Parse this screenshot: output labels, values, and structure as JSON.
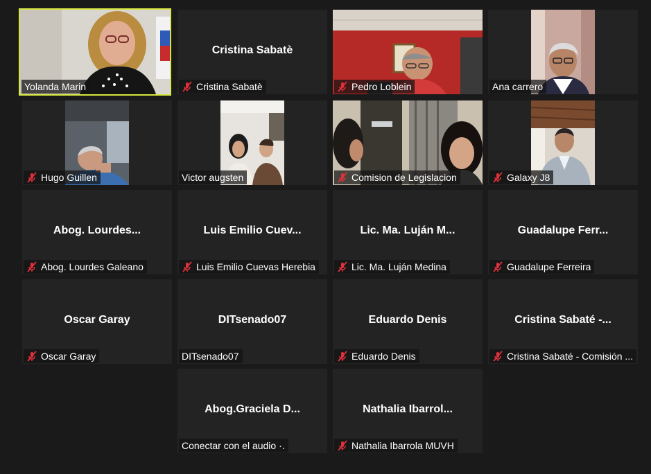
{
  "colors": {
    "background": "#1a1a1a",
    "tile": "#232323",
    "active_speaker_border": "#d8e83a",
    "mute_icon": "#e0313b",
    "text": "#ffffff"
  },
  "participants": [
    {
      "id": "yolanda",
      "label": "Yolanda Marin",
      "muted": false,
      "video": true,
      "active": true
    },
    {
      "id": "cristina1",
      "center_name": "Cristina Sabatè",
      "label": "Cristina Sabatè",
      "muted": true,
      "video": false
    },
    {
      "id": "pedro",
      "label": "Pedro Loblein",
      "muted": true,
      "video": true
    },
    {
      "id": "ana",
      "label": "Ana carrero",
      "muted": false,
      "video": true
    },
    {
      "id": "hugo",
      "label": "Hugo Guillen",
      "muted": true,
      "video": true
    },
    {
      "id": "victor",
      "label": "Victor augsten",
      "muted": false,
      "video": true
    },
    {
      "id": "comision",
      "label": "Comision de Legislacion",
      "muted": true,
      "video": true
    },
    {
      "id": "galaxy",
      "label": "Galaxy J8",
      "muted": true,
      "video": true
    },
    {
      "id": "lourdes",
      "center_name": "Abog.  Lourdes...",
      "label": "Abog. Lourdes Galeano",
      "muted": true,
      "video": false
    },
    {
      "id": "luis",
      "center_name": "Luis  Emilio  Cuev...",
      "label": "Luis Emilio Cuevas Herebia",
      "muted": true,
      "video": false
    },
    {
      "id": "lujan",
      "center_name": "Lic.  Ma.  Luján  M...",
      "label": "Lic. Ma. Luján Medina",
      "muted": true,
      "video": false
    },
    {
      "id": "guadalupe",
      "center_name": "Guadalupe  Ferr...",
      "label": "Guadalupe Ferreira",
      "muted": true,
      "video": false
    },
    {
      "id": "oscar",
      "center_name": "Oscar Garay",
      "label": "Oscar Garay",
      "muted": true,
      "video": false
    },
    {
      "id": "dit",
      "center_name": "DITsenado07",
      "label": "DITsenado07",
      "muted": false,
      "video": false
    },
    {
      "id": "eduardo",
      "center_name": "Eduardo Denis",
      "label": "Eduardo Denis",
      "muted": true,
      "video": false
    },
    {
      "id": "cristina2",
      "center_name": "Cristina  Sabaté  -...",
      "label": "Cristina Sabaté - Comisión ...",
      "muted": true,
      "video": false
    },
    {
      "id": "graciela",
      "center_name": "Abog.Graciela  D...",
      "label": "Conectar con el audio ·.",
      "muted": false,
      "video": false
    },
    {
      "id": "nathalia",
      "center_name": "Nathalia  Ibarrol...",
      "label": "Nathalia Ibarrola MUVH",
      "muted": true,
      "video": false
    }
  ]
}
